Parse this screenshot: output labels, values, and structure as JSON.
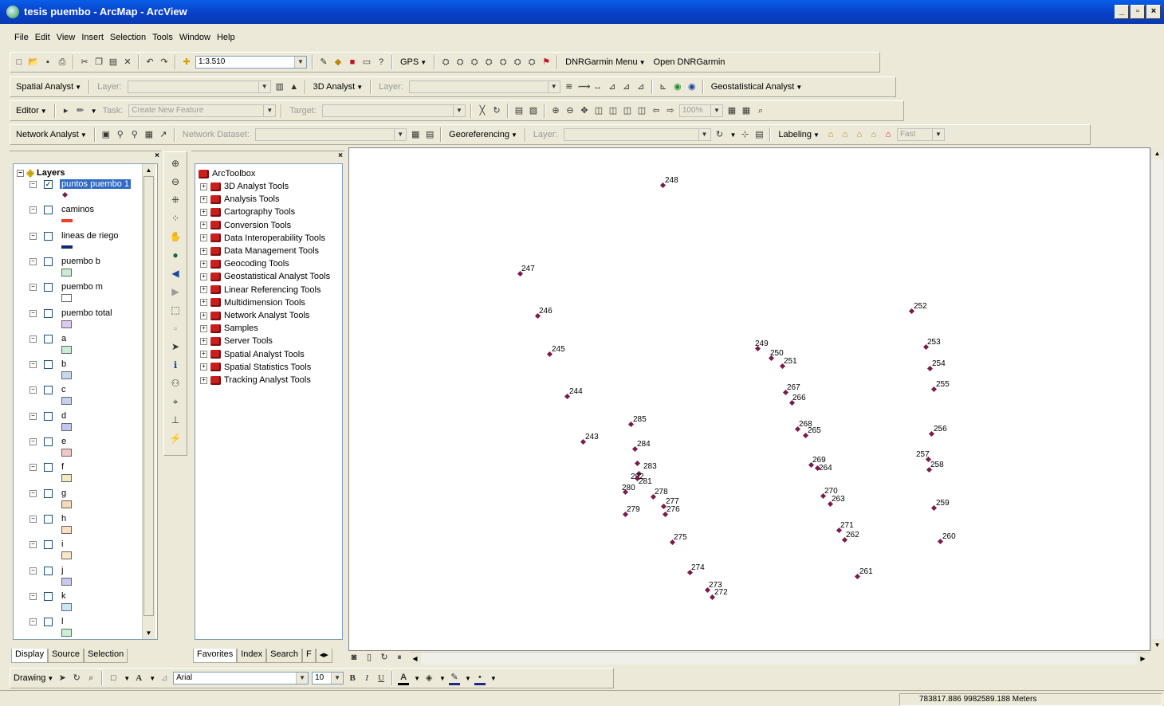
{
  "app": {
    "title": "tesis puembo - ArcMap - ArcView"
  },
  "window_buttons": {
    "minimize": "_",
    "maximize": "▫",
    "close": "×"
  },
  "menu": [
    "File",
    "Edit",
    "View",
    "Insert",
    "Selection",
    "Tools",
    "Window",
    "Help"
  ],
  "standard_toolbar": {
    "scale": "1:3.510",
    "gps": "GPS",
    "dnrgarmin_menu": "DNRGarmin Menu",
    "open_dnrgarmin": "Open DNRGarmin"
  },
  "spatial_toolbar": {
    "spatial_analyst": "Spatial Analyst",
    "layer_label": "Layer:",
    "analyst_3d": "3D Analyst",
    "layer_label2": "Layer:",
    "geostatistical": "Geostatistical Analyst"
  },
  "editor_toolbar": {
    "editor": "Editor",
    "task_label": "Task:",
    "task_value": "Create New Feature",
    "target_label": "Target:",
    "zoom": "100%"
  },
  "network_toolbar": {
    "network_analyst": "Network Analyst",
    "dataset_label": "Network Dataset:",
    "georeferencing": "Georeferencing",
    "layer_label": "Layer:",
    "labeling": "Labeling",
    "fast": "Fast"
  },
  "toc": {
    "root": "Layers",
    "layers": [
      {
        "name": "puntos puembo 1",
        "checked": true,
        "selected": true,
        "symbol": "point",
        "color": "#7a1a4a"
      },
      {
        "name": "caminos",
        "checked": false,
        "symbol": "line",
        "color": "#e8402a"
      },
      {
        "name": "lineas de riego",
        "checked": false,
        "symbol": "line",
        "color": "#102a7a"
      },
      {
        "name": "puembo b",
        "checked": false,
        "symbol": "fill",
        "color": "#c8ecd8"
      },
      {
        "name": "puembo m",
        "checked": false,
        "symbol": "fill",
        "color": "#ffffff"
      },
      {
        "name": "puembo total",
        "checked": false,
        "symbol": "fill",
        "color": "#dcc8f0"
      },
      {
        "name": "a",
        "checked": false,
        "symbol": "fill",
        "color": "#c8ecd8"
      },
      {
        "name": "b",
        "checked": false,
        "symbol": "fill",
        "color": "#c8d8f0"
      },
      {
        "name": "c",
        "checked": false,
        "symbol": "fill",
        "color": "#c8d0f0"
      },
      {
        "name": "d",
        "checked": false,
        "symbol": "fill",
        "color": "#c0c8f0"
      },
      {
        "name": "e",
        "checked": false,
        "symbol": "fill",
        "color": "#f0c8c8"
      },
      {
        "name": "f",
        "checked": false,
        "symbol": "fill",
        "color": "#f0ecc0"
      },
      {
        "name": "g",
        "checked": false,
        "symbol": "fill",
        "color": "#f8d8b8"
      },
      {
        "name": "h",
        "checked": false,
        "symbol": "fill",
        "color": "#f8e0c0"
      },
      {
        "name": "i",
        "checked": false,
        "symbol": "fill",
        "color": "#f8e8c8"
      },
      {
        "name": "j",
        "checked": false,
        "symbol": "fill",
        "color": "#c8c8f0"
      },
      {
        "name": "k",
        "checked": false,
        "symbol": "fill",
        "color": "#c8e8f8"
      },
      {
        "name": "l",
        "checked": false,
        "symbol": "fill",
        "color": "#c8f0d8"
      }
    ],
    "tabs": [
      "Display",
      "Source",
      "Selection"
    ]
  },
  "arctoolbox": {
    "root": "ArcToolbox",
    "items": [
      "3D Analyst Tools",
      "Analysis Tools",
      "Cartography Tools",
      "Conversion Tools",
      "Data Interoperability Tools",
      "Data Management Tools",
      "Geocoding Tools",
      "Geostatistical Analyst Tools",
      "Linear Referencing Tools",
      "Multidimension Tools",
      "Network Analyst Tools",
      "Samples",
      "Server Tools",
      "Spatial Analyst Tools",
      "Spatial Statistics Tools",
      "Tracking Analyst Tools"
    ],
    "tabs": [
      "Favorites",
      "Index",
      "Search",
      "F"
    ]
  },
  "map_points": [
    {
      "label": "248"
    },
    {
      "label": "247"
    },
    {
      "label": "246"
    },
    {
      "label": "245"
    },
    {
      "label": "244"
    },
    {
      "label": "243"
    },
    {
      "label": "285"
    },
    {
      "label": "284"
    },
    {
      "label": "283"
    },
    {
      "label": "282"
    },
    {
      "label": "281"
    },
    {
      "label": "280"
    },
    {
      "label": "279"
    },
    {
      "label": "278"
    },
    {
      "label": "277"
    },
    {
      "label": "276"
    },
    {
      "label": "275"
    },
    {
      "label": "274"
    },
    {
      "label": "273"
    },
    {
      "label": "272"
    },
    {
      "label": "249"
    },
    {
      "label": "250"
    },
    {
      "label": "251"
    },
    {
      "label": "267"
    },
    {
      "label": "266"
    },
    {
      "label": "268"
    },
    {
      "label": "265"
    },
    {
      "label": "269"
    },
    {
      "label": "264"
    },
    {
      "label": "270"
    },
    {
      "label": "263"
    },
    {
      "label": "271"
    },
    {
      "label": "262"
    },
    {
      "label": "261"
    },
    {
      "label": "252"
    },
    {
      "label": "253"
    },
    {
      "label": "254"
    },
    {
      "label": "255"
    },
    {
      "label": "256"
    },
    {
      "label": "257"
    },
    {
      "label": "258"
    },
    {
      "label": "259"
    },
    {
      "label": "260"
    }
  ],
  "drawing_toolbar": {
    "drawing": "Drawing",
    "font": "Arial",
    "size": "10",
    "bold": "B",
    "italic": "I",
    "underline": "U"
  },
  "status": {
    "coordinates": "783817.886  9982589.188 Meters"
  }
}
